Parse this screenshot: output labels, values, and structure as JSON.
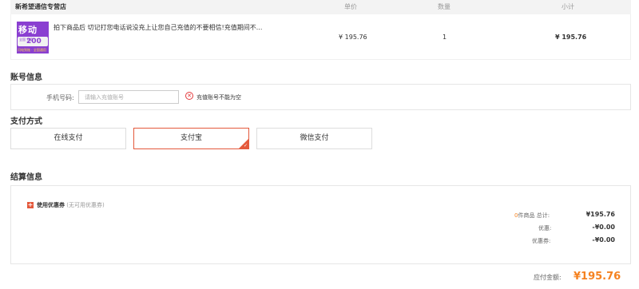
{
  "table": {
    "shop": "新希望通信专营店",
    "col_price": "单价",
    "col_qty": "数量",
    "col_subtotal": "小计"
  },
  "product": {
    "image_text": {
      "title": "移动",
      "small": "全国 充值",
      "amount": "200元",
      "footer": "闪电到账 · 全国通用"
    },
    "name": "拍下商品后 切记打您电话说没充上让您自己充值的不要相信!充值期间不...",
    "price": "¥ 195.76",
    "qty": "1",
    "subtotal": "¥ 195.76"
  },
  "account": {
    "title": "账号信息",
    "phone_label": "手机号码:",
    "phone_placeholder": "请输入充值账号",
    "error": "充值账号不能为空"
  },
  "payment": {
    "title": "支付方式",
    "options": [
      "在线支付",
      "支付宝",
      "微信支付"
    ],
    "selected": "支付宝"
  },
  "settle": {
    "title": "结算信息",
    "coupon_label": "使用优惠券",
    "coupon_note": "(无可用优惠券)",
    "goods_count": "0",
    "goods_label": "件商品  总计:",
    "goods_total": "¥195.76",
    "discount_label": "优惠:",
    "discount": "-¥0.00",
    "voucher_label": "优惠券:",
    "voucher": "-¥0.00",
    "payable_label": "应付金额:",
    "payable": "¥195.76"
  },
  "colors": {
    "accent": "#f58220",
    "error": "#e4393c",
    "selected_border": "#e4593c"
  }
}
